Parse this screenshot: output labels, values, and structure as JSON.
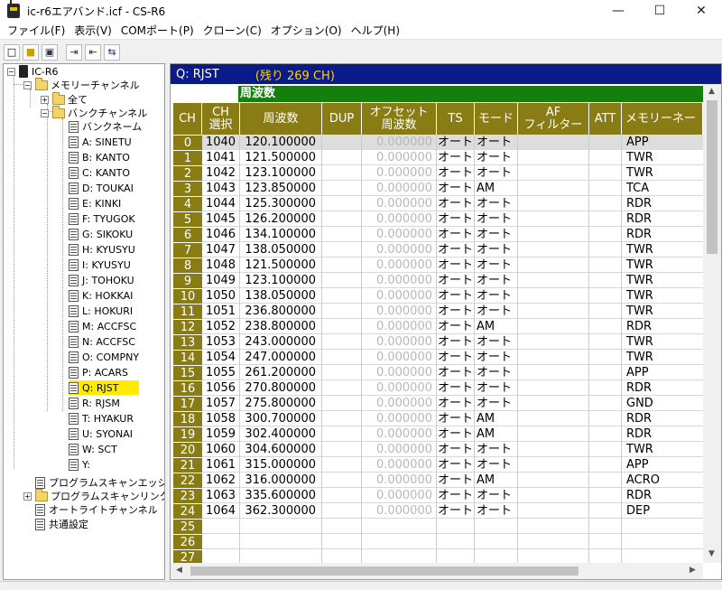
{
  "window": {
    "title": "ic-r6エアバンド.icf - CS-R6"
  },
  "menu": [
    "ファイル(F)",
    "表示(V)",
    "COMポート(P)",
    "クローン(C)",
    "オプション(O)",
    "ヘルプ(H)"
  ],
  "tree": {
    "root": "IC-R6",
    "memory": "メモリーチャンネル",
    "all": "全て",
    "bank": "バンクチャンネル",
    "bank_name": "バンクネーム",
    "banks": [
      "A: SINETU",
      "B: KANTO",
      "C: KANTO",
      "D: TOUKAI",
      "E: KINKI",
      "F: TYUGOK",
      "G: SIKOKU",
      "H: KYUSYU",
      "I: KYUSYU",
      "J: TOHOKU",
      "K: HOKKAI",
      "L: HOKURI",
      "M: ACCFSC",
      "N: ACCFSC",
      "O: COMPNY",
      "P: ACARS",
      "Q: RJST",
      "R: RJSM",
      "T: HYAKUR",
      "U: SYONAI",
      "W: SCT",
      "Y:"
    ],
    "scan_edge": "プログラムスキャンエッジ",
    "scan_link": "プログラムスキャンリンク",
    "auto_write": "オートライトチャンネル",
    "common": "共通設定"
  },
  "bank_header": {
    "name": "Q: RJST",
    "remain": "(残り 269 CH)"
  },
  "group_label": "周波数",
  "columns": {
    "ch": "CH",
    "sel": "CH\n選択",
    "freq": "周波数",
    "dup": "DUP",
    "offset": "オフセット\n周波数",
    "ts": "TS",
    "mode": "モード",
    "af": "AF\nフィルター",
    "att": "ATT",
    "memo": "メモリーネー"
  },
  "rows": [
    {
      "ch": "0",
      "sel": "1040",
      "freq": "120.100000",
      "off": "0.000000",
      "ts": "オート",
      "mode": "オート",
      "memo": "APP"
    },
    {
      "ch": "1",
      "sel": "1041",
      "freq": "121.500000",
      "off": "0.000000",
      "ts": "オート",
      "mode": "オート",
      "memo": "TWR"
    },
    {
      "ch": "2",
      "sel": "1042",
      "freq": "123.100000",
      "off": "0.000000",
      "ts": "オート",
      "mode": "オート",
      "memo": "TWR"
    },
    {
      "ch": "3",
      "sel": "1043",
      "freq": "123.850000",
      "off": "0.000000",
      "ts": "オート",
      "mode": "AM",
      "memo": "TCA"
    },
    {
      "ch": "4",
      "sel": "1044",
      "freq": "125.300000",
      "off": "0.000000",
      "ts": "オート",
      "mode": "オート",
      "memo": "RDR"
    },
    {
      "ch": "5",
      "sel": "1045",
      "freq": "126.200000",
      "off": "0.000000",
      "ts": "オート",
      "mode": "オート",
      "memo": "RDR"
    },
    {
      "ch": "6",
      "sel": "1046",
      "freq": "134.100000",
      "off": "0.000000",
      "ts": "オート",
      "mode": "オート",
      "memo": "RDR"
    },
    {
      "ch": "7",
      "sel": "1047",
      "freq": "138.050000",
      "off": "0.000000",
      "ts": "オート",
      "mode": "オート",
      "memo": "TWR"
    },
    {
      "ch": "8",
      "sel": "1048",
      "freq": "121.500000",
      "off": "0.000000",
      "ts": "オート",
      "mode": "オート",
      "memo": "TWR"
    },
    {
      "ch": "9",
      "sel": "1049",
      "freq": "123.100000",
      "off": "0.000000",
      "ts": "オート",
      "mode": "オート",
      "memo": "TWR"
    },
    {
      "ch": "10",
      "sel": "1050",
      "freq": "138.050000",
      "off": "0.000000",
      "ts": "オート",
      "mode": "オート",
      "memo": "TWR"
    },
    {
      "ch": "11",
      "sel": "1051",
      "freq": "236.800000",
      "off": "0.000000",
      "ts": "オート",
      "mode": "オート",
      "memo": "TWR"
    },
    {
      "ch": "12",
      "sel": "1052",
      "freq": "238.800000",
      "off": "0.000000",
      "ts": "オート",
      "mode": "AM",
      "memo": "RDR"
    },
    {
      "ch": "13",
      "sel": "1053",
      "freq": "243.000000",
      "off": "0.000000",
      "ts": "オート",
      "mode": "オート",
      "memo": "TWR"
    },
    {
      "ch": "14",
      "sel": "1054",
      "freq": "247.000000",
      "off": "0.000000",
      "ts": "オート",
      "mode": "オート",
      "memo": "TWR"
    },
    {
      "ch": "15",
      "sel": "1055",
      "freq": "261.200000",
      "off": "0.000000",
      "ts": "オート",
      "mode": "オート",
      "memo": "APP"
    },
    {
      "ch": "16",
      "sel": "1056",
      "freq": "270.800000",
      "off": "0.000000",
      "ts": "オート",
      "mode": "オート",
      "memo": "RDR"
    },
    {
      "ch": "17",
      "sel": "1057",
      "freq": "275.800000",
      "off": "0.000000",
      "ts": "オート",
      "mode": "オート",
      "memo": "GND"
    },
    {
      "ch": "18",
      "sel": "1058",
      "freq": "300.700000",
      "off": "0.000000",
      "ts": "オート",
      "mode": "AM",
      "memo": "RDR"
    },
    {
      "ch": "19",
      "sel": "1059",
      "freq": "302.400000",
      "off": "0.000000",
      "ts": "オート",
      "mode": "AM",
      "memo": "RDR"
    },
    {
      "ch": "20",
      "sel": "1060",
      "freq": "304.600000",
      "off": "0.000000",
      "ts": "オート",
      "mode": "オート",
      "memo": "TWR"
    },
    {
      "ch": "21",
      "sel": "1061",
      "freq": "315.000000",
      "off": "0.000000",
      "ts": "オート",
      "mode": "オート",
      "memo": "APP"
    },
    {
      "ch": "22",
      "sel": "1062",
      "freq": "316.000000",
      "off": "0.000000",
      "ts": "オート",
      "mode": "AM",
      "memo": "ACRO"
    },
    {
      "ch": "23",
      "sel": "1063",
      "freq": "335.600000",
      "off": "0.000000",
      "ts": "オート",
      "mode": "オート",
      "memo": "RDR"
    },
    {
      "ch": "24",
      "sel": "1064",
      "freq": "362.300000",
      "off": "0.000000",
      "ts": "オート",
      "mode": "オート",
      "memo": "DEP"
    },
    {
      "ch": "25",
      "sel": "",
      "freq": "",
      "off": "",
      "ts": "",
      "mode": "",
      "memo": ""
    },
    {
      "ch": "26",
      "sel": "",
      "freq": "",
      "off": "",
      "ts": "",
      "mode": "",
      "memo": ""
    },
    {
      "ch": "27",
      "sel": "",
      "freq": "",
      "off": "",
      "ts": "",
      "mode": "",
      "memo": ""
    }
  ]
}
